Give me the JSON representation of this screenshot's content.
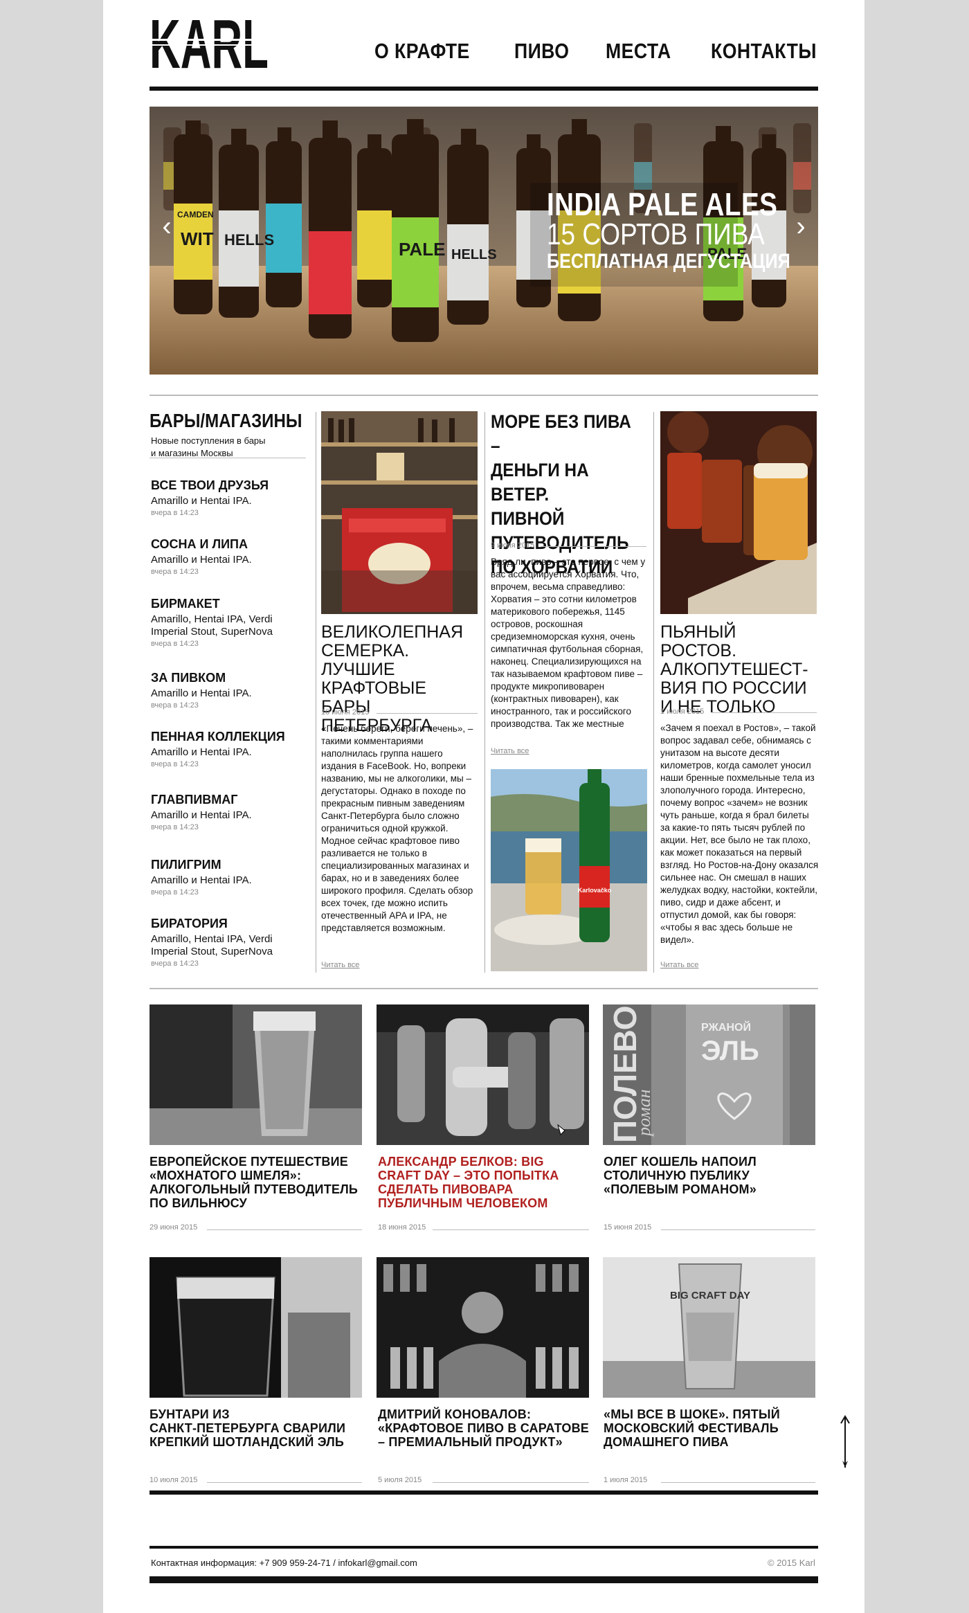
{
  "header": {
    "logo": "KARL",
    "nav": [
      "О КРАФТЕ",
      "ПИВО",
      "МЕСТА",
      "КОНТАКТЫ"
    ]
  },
  "hero": {
    "line1": "INDIA PALE ALES",
    "line2": "15 СОРТОВ ПИВА",
    "line3": "БЕСПЛАТНАЯ ДЕГУСТАЦИЯ",
    "prev": "‹",
    "next": "›",
    "bottle_labels": [
      "CAMDEN",
      "WIT",
      "HELLS",
      "PALE",
      "HELLS",
      "PALE"
    ]
  },
  "sidebar": {
    "title": "БАРЫ/МАГАЗИНЫ",
    "subtitle_line1": "Новые поступления в бары",
    "subtitle_line2": "и магазины Москвы",
    "items": [
      {
        "name": "ВСЕ ТВОИ ДРУЗЬЯ",
        "desc": "Amarillo и Hentai IPA.",
        "time": "вчера в 14:23"
      },
      {
        "name": "СОСНА И ЛИПА",
        "desc": "Amarillo и Hentai IPA.",
        "time": "вчера в 14:23"
      },
      {
        "name": "БИРМАКЕТ",
        "desc": "Amarillo, Hentai IPA, Verdi Imperial Stout, SuperNova",
        "time": "вчера в 14:23"
      },
      {
        "name": "ЗА ПИВКОМ",
        "desc": "Amarillo и Hentai IPA.",
        "time": "вчера в 14:23"
      },
      {
        "name": "ПЕННАЯ КОЛЛЕКЦИЯ",
        "desc": "Amarillo и Hentai IPA.",
        "time": "вчера в 14:23"
      },
      {
        "name": "ГЛАВПИВМАГ",
        "desc": "Amarillo и Hentai IPA.",
        "time": "вчера в 14:23"
      },
      {
        "name": "ПИЛИГРИМ",
        "desc": "Amarillo и Hentai IPA.",
        "time": "вчера в 14:23"
      },
      {
        "name": "БИРАТОРИЯ",
        "desc": "Amarillo, Hentai IPA, Verdi Imperial Stout, SuperNova",
        "time": "вчера в 14:23"
      }
    ]
  },
  "articles": {
    "a1": {
      "title_l1": "ВЕЛИКОЛЕПНАЯ",
      "title_l2": "СЕМЕРКА. ЛУЧШИЕ",
      "title_l3": "КРАФТОВЫЕ БАРЫ",
      "title_l4": "ПЕТЕРБУРГА",
      "date": "10 июля 2015",
      "body": "«Печень береги, береги печень», – такими комментариями наполнилась группа нашего издания в FaceBook. Но, вопреки названию, мы не алкоголики, мы – дегустаторы. Однако в походе по прекрасным пивным заведениям Санкт-Петербурга было сложно ограничиться одной кружкой. Модное сейчас крафтовое пиво разливается не только в специализированных магазинах и барах, но и в заведениях более широкого профиля. Сделать обзор всех точек, где можно испить отечественный APA и IPA, не представляется возможным.",
      "read_more": "Читать все"
    },
    "a2": {
      "title_l1": "МОРЕ БЕЗ ПИВА –",
      "title_l2": "ДЕНЬГИ НА ВЕТЕР.",
      "title_l3": "ПИВНОЙ",
      "title_l4": "ПУТЕВОДИТЕЛЬ",
      "title_l5": "ПО ХОРВАТИИ",
      "date": "9 июля 2015",
      "body": "Вряд ли, пиво – это первое, с чем у вас ассоциируется Хорватия. Что, впрочем, весьма справедливо: Хорватия – это сотни километров материкового побережья, 1145 островов, роскошная средиземноморская кухня, очень симпатичная футбольная сборная, наконец. Специализирующихся на так называемом крафтовом пиве – продукте микропивоварен (контрактных пивоварен), как иностранного, так и российского производства. Так же местные",
      "read_more": "Читать все",
      "bottle_label": "Karlovačko"
    },
    "a3": {
      "title_l1": "ПЬЯНЫЙ РОСТОВ.",
      "title_l2": "АЛКОПУТЕШЕСТ-",
      "title_l3": "ВИЯ ПО РОССИИ",
      "title_l4": "И НЕ ТОЛЬКО",
      "date": "1 июля 2015",
      "body": "«Зачем я поехал в Ростов», – такой вопрос задавал себе, обнимаясь с унитазом на высоте десяти километров, когда самолет уносил наши бренные похмельные тела из злополучного города. Интересно, почему вопрос «зачем» не возник чуть раньше, когда я брал билеты за какие-то пять тысяч рублей по акции. Нет, все было не так плохо, как может показаться на первый взгляд. Но Ростов-на-Дону оказался сильнее нас. Он смешал в наших желудках водку, настойки, коктейли, пиво, сидр и даже абсент, и отпустил домой, как бы говоря: «чтобы я вас здесь больше не видел».",
      "read_more": "Читать все"
    }
  },
  "grid": [
    {
      "l1": "ЕВРОПЕЙСКОЕ ПУТЕШЕСТВИЕ",
      "l2": "«МОХНАТОГО ШМЕЛЯ»:",
      "l3": "АЛКОГОЛЬНЫЙ ПУТЕВОДИТЕЛЬ",
      "l4": "ПО ВИЛЬНЮСУ",
      "date": "29 июня 2015"
    },
    {
      "l1": "АЛЕКСАНДР БЕЛКОВ: BIG",
      "l2": "CRAFT DAY – ЭТО ПОПЫТКА",
      "l3": "СДЕЛАТЬ ПИВОВАРА",
      "l4": "ПУБЛИЧНЫМ ЧЕЛОВЕКОМ",
      "date": "18 июня 2015"
    },
    {
      "l1": "ОЛЕГ КОШЕЛЬ НАПОИЛ",
      "l2": "СТОЛИЧНУЮ ПУБЛИКУ",
      "l3": "«ПОЛЕВЫМ РОМАНОМ»",
      "l4": "",
      "date": "15 июня 2015",
      "poster_l1": "ПОЛЕВОЙ",
      "poster_l2": "роман",
      "poster_l3": "РЖАНОЙ",
      "poster_l4": "ЭЛЬ"
    },
    {
      "l1": "БУНТАРИ ИЗ",
      "l2": "САНКТ-ПЕТЕРБУРГА СВАРИЛИ",
      "l3": "КРЕПКИЙ ШОТЛАНДСКИЙ ЭЛЬ",
      "l4": "",
      "date": "10 июля 2015"
    },
    {
      "l1": "ДМИТРИЙ КОНОВАЛОВ:",
      "l2": "«КРАФТОВОЕ ПИВО В САРАТОВЕ",
      "l3": "– ПРЕМИАЛЬНЫЙ ПРОДУКТ»",
      "l4": "",
      "date": "5 июля 2015"
    },
    {
      "l1": "«МЫ ВСЕ В ШОКЕ». ПЯТЫЙ",
      "l2": "МОСКОВСКИЙ ФЕСТИВАЛЬ",
      "l3": "ДОМАШНЕГО ПИВА",
      "l4": "",
      "date": "1 июля 2015",
      "glass_text": "BIG CRAFT DAY"
    }
  ],
  "footer": {
    "contact": "Контактная информация: +7 909 959-24-71  /  infokarl@gmail.com",
    "copyright": "© 2015 Karl"
  },
  "colors": {
    "accent_red": "#b0201f",
    "text": "#111111",
    "page_bg": "#d9d9d9"
  }
}
